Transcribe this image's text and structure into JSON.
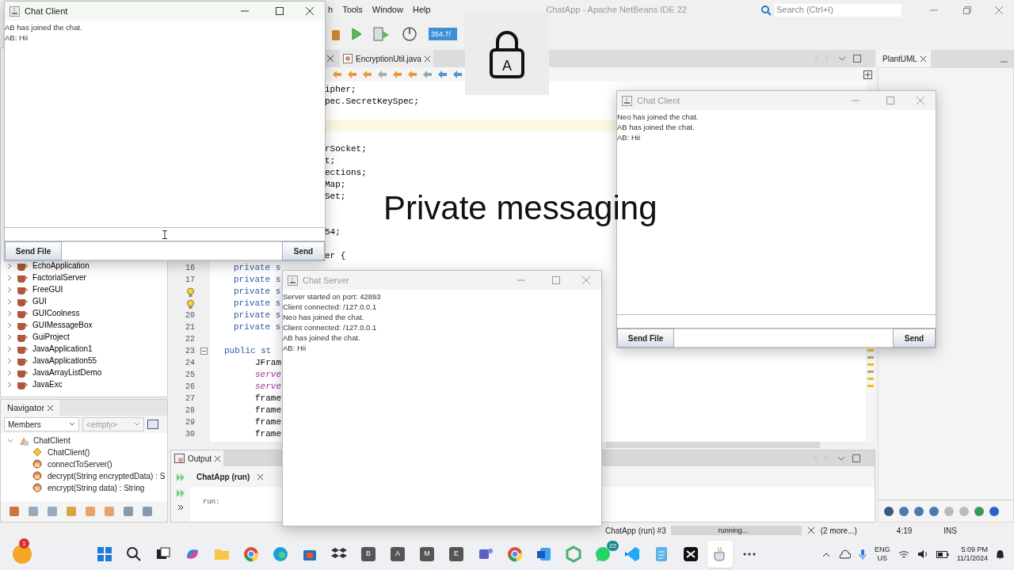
{
  "ide": {
    "title": "ChatApp - Apache NetBeans IDE 22",
    "menus": [
      "h",
      "Tools",
      "Window",
      "Help"
    ],
    "search": {
      "placeholder": "Search (Ctrl+I)"
    },
    "memory": "354.7/",
    "editor_tabs": [
      {
        "label": "EncryptionUtil.java",
        "selected": false
      }
    ],
    "code_top": [
      {
        "text": "ipher;",
        "current": false
      },
      {
        "text": "pec.SecretKeySpec;",
        "current": false
      },
      {
        "current": false
      },
      {
        "current": true
      },
      {
        "current": false
      },
      {
        "text": "rSocket;",
        "current": false
      },
      {
        "text": "t;",
        "current": false
      },
      {
        "text": "ections;",
        "current": false
      },
      {
        "text": "Map;",
        "current": false
      },
      {
        "text": "Set;",
        "current": false
      },
      {
        "current": false
      },
      {
        "current": false
      },
      {
        "text": "54;",
        "current": false
      },
      {
        "current": false
      },
      {
        "text": "er {",
        "current": false
      }
    ],
    "code_lines": [
      {
        "number": "16",
        "hint": false,
        "kind": "field",
        "text": "private s"
      },
      {
        "number": "17",
        "hint": false,
        "kind": "field",
        "text": "private s"
      },
      {
        "hint": true,
        "kind": "field",
        "text": "private s"
      },
      {
        "hint": true,
        "kind": "field",
        "text": "private s"
      },
      {
        "number": "20",
        "hint": false,
        "kind": "field",
        "text": "private s"
      },
      {
        "number": "21",
        "hint": false,
        "kind": "field",
        "text": "private s"
      },
      {
        "number": "22",
        "hint": false,
        "kind": "blank"
      },
      {
        "number": "23",
        "hint": false,
        "kind": "decl",
        "text": "public st"
      },
      {
        "number": "24",
        "hint": false,
        "kind": "stmt",
        "text": "JFram"
      },
      {
        "number": "25",
        "hint": false,
        "kind": "static",
        "text": "serve"
      },
      {
        "number": "26",
        "hint": false,
        "kind": "static",
        "text": "serve"
      },
      {
        "number": "27",
        "hint": false,
        "kind": "stmt",
        "text": "frame"
      },
      {
        "number": "28",
        "hint": false,
        "kind": "stmt",
        "text": "frame"
      },
      {
        "number": "29",
        "hint": false,
        "kind": "stmt",
        "text": "frame"
      },
      {
        "number": "30",
        "hint": false,
        "kind": "stmt",
        "text": "frame"
      }
    ],
    "projects": [
      "EchoApplication",
      "FactorialServer",
      "FreeGUI",
      "GUI",
      "GUICoolness",
      "GUIMessageBox",
      "GuiProject",
      "JavaApplication1",
      "JavaApplication55",
      "JavaArrayListDemo",
      "JavaExc"
    ],
    "navigator": {
      "title": "Navigator",
      "filter": "Members",
      "secondary": "<empty>",
      "tree": [
        {
          "label": "ChatClient",
          "kind": "class",
          "expanded": true,
          "children": [
            {
              "label": "ChatClient()",
              "kind": "constructor"
            },
            {
              "label": "connectToServer()",
              "kind": "method"
            },
            {
              "label": "decrypt(String encryptedData) : S",
              "kind": "method"
            },
            {
              "label": "encrypt(String data) : String",
              "kind": "method"
            }
          ]
        }
      ]
    },
    "output": {
      "title": "Output",
      "run_tab": "ChatApp (run)",
      "text": "run:"
    },
    "right_panel": {
      "title": "PlantUML"
    },
    "status": {
      "task": "ChatApp (run) #3",
      "progress": {
        "text": "running...",
        "level": 1
      },
      "more": "(2 more...)",
      "position": "4:19",
      "mode": "INS"
    }
  },
  "windows": [
    {
      "title": "Chat Client",
      "kind": "client",
      "focused": true,
      "messages": [
        "AB has joined the chat.",
        "AB: Hii"
      ],
      "file_button": "Send File",
      "send_button": "Send"
    },
    {
      "title": "Chat Client",
      "kind": "client",
      "focused": false,
      "messages": [
        "Neo has joined the chat.",
        "AB has joined the chat.",
        "AB: Hii"
      ],
      "file_button": "Send File",
      "send_button": "Send"
    },
    {
      "title": "Chat Server",
      "kind": "server",
      "focused": false,
      "messages": [
        "Server started on port: 42893",
        "Client connected: /127.0.0.1",
        "Neo has joined the chat.",
        "Client connected: /127.0.0.1",
        "AB has joined the chat.",
        "AB: Hii"
      ]
    }
  ],
  "caps_lock": {
    "label": "A"
  },
  "caption": "Private messaging",
  "taskbar": {
    "notification_badge": "1",
    "apps": [
      {
        "kind": "start",
        "selected": false
      },
      {
        "kind": "search",
        "selected": false
      },
      {
        "kind": "taskview",
        "selected": false
      },
      {
        "kind": "copilot",
        "selected": false
      },
      {
        "kind": "folder",
        "selected": false
      },
      {
        "kind": "chrome",
        "selected": false
      },
      {
        "kind": "edge",
        "selected": false
      },
      {
        "kind": "store",
        "selected": false
      },
      {
        "kind": "dropbox",
        "selected": false
      },
      {
        "kind": "letter",
        "label": "B",
        "selected": false
      },
      {
        "kind": "letter",
        "label": "A",
        "selected": false
      },
      {
        "kind": "letter",
        "label": "M",
        "selected": false
      },
      {
        "kind": "letter",
        "label": "E",
        "selected": false
      },
      {
        "kind": "teams",
        "selected": false
      },
      {
        "kind": "chrome",
        "selected": false
      },
      {
        "kind": "word",
        "selected": false
      },
      {
        "kind": "cube",
        "selected": false
      },
      {
        "kind": "whatsapp",
        "badge": "22",
        "selected": false
      },
      {
        "kind": "vscode",
        "selected": false
      },
      {
        "kind": "notepad",
        "selected": false
      },
      {
        "kind": "capcut",
        "selected": false
      },
      {
        "kind": "java",
        "selected": true
      },
      {
        "kind": "more",
        "selected": false
      }
    ],
    "tray": {
      "language": "ENG",
      "region": "US",
      "time": "5:09 PM",
      "date": "11/1/2024"
    }
  }
}
